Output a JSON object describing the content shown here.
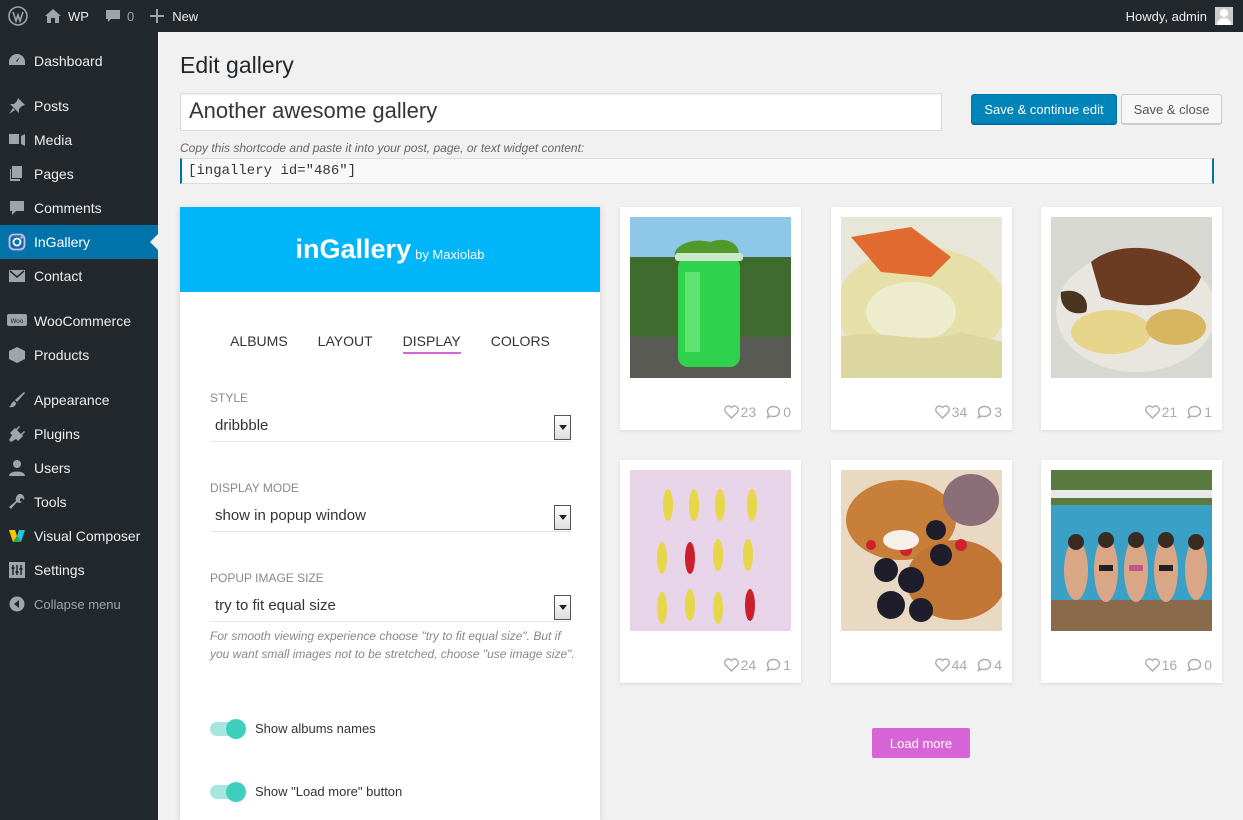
{
  "adminbar": {
    "site_name": "WP",
    "comments_count": "0",
    "new_label": "New",
    "greeting": "Howdy, admin"
  },
  "sidebar": {
    "items": [
      {
        "label": "Dashboard",
        "icon": "dashboard-icon"
      },
      {
        "label": "Posts",
        "icon": "pin-icon"
      },
      {
        "label": "Media",
        "icon": "media-icon"
      },
      {
        "label": "Pages",
        "icon": "pages-icon"
      },
      {
        "label": "Comments",
        "icon": "comment-icon"
      },
      {
        "label": "InGallery",
        "icon": "instagram-icon",
        "active": true
      },
      {
        "label": "Contact",
        "icon": "mail-icon"
      },
      {
        "label": "WooCommerce",
        "icon": "woo-icon"
      },
      {
        "label": "Products",
        "icon": "box-icon"
      },
      {
        "label": "Appearance",
        "icon": "brush-icon"
      },
      {
        "label": "Plugins",
        "icon": "plug-icon"
      },
      {
        "label": "Users",
        "icon": "user-icon"
      },
      {
        "label": "Tools",
        "icon": "wrench-icon"
      },
      {
        "label": "Visual Composer",
        "icon": "vc-icon"
      },
      {
        "label": "Settings",
        "icon": "settings-icon"
      },
      {
        "label": "Collapse menu",
        "icon": "collapse-icon"
      }
    ]
  },
  "main": {
    "title": "Edit gallery",
    "gallery_name": "Another awesome gallery",
    "save_continue": "Save & continue edit",
    "save_close": "Save & close",
    "shortcode_note": "Copy this shortcode and paste it into your post, page, or text widget content:",
    "shortcode": "[ingallery id=\"486\"]"
  },
  "panel": {
    "brand": "inGallery",
    "brand_by": "by Maxiolab",
    "tabs": [
      "ALBUMS",
      "LAYOUT",
      "DISPLAY",
      "COLORS"
    ],
    "active_tab": "DISPLAY",
    "style_label": "STYLE",
    "style_value": "dribbble",
    "display_mode_label": "DISPLAY MODE",
    "display_mode_value": "show in popup window",
    "popup_size_label": "POPUP IMAGE SIZE",
    "popup_size_value": "try to fit equal size",
    "help_text": "For smooth viewing experience choose \"try to fit equal size\". But if you want small images not to be stretched, choose \"use image size\".",
    "toggle_albums_label": "Show albums names",
    "toggle_loadmore_label": "Show \"Load more\" button"
  },
  "gallery": {
    "cards": [
      {
        "likes": "23",
        "comments": "0",
        "photo": "green-drink"
      },
      {
        "likes": "34",
        "comments": "3",
        "photo": "ravioli"
      },
      {
        "likes": "21",
        "comments": "1",
        "photo": "steak"
      },
      {
        "likes": "24",
        "comments": "1",
        "photo": "peppers"
      },
      {
        "likes": "44",
        "comments": "4",
        "photo": "pancakes"
      },
      {
        "likes": "16",
        "comments": "0",
        "photo": "pool-girls"
      }
    ],
    "load_more": "Load more"
  },
  "colors": {
    "primary": "#0085ba",
    "sidebar": "#23282d",
    "header": "#00b6f8",
    "accent": "#d865d8",
    "toggle": "#3ecfbf"
  }
}
